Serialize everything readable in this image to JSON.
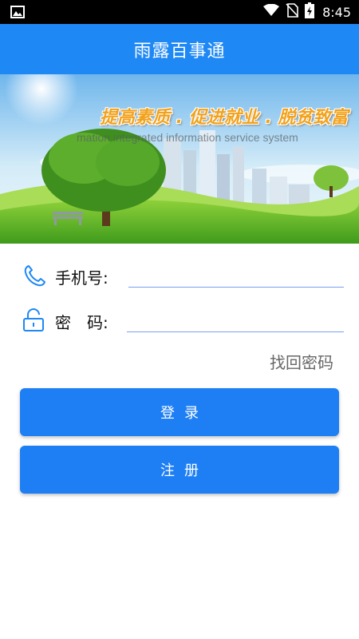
{
  "status_bar": {
    "time": "8:45",
    "icons": [
      "image-icon",
      "wifi-icon",
      "no-sim-icon",
      "battery-charging-icon"
    ]
  },
  "app_bar": {
    "title": "雨露百事通"
  },
  "banner": {
    "slogan": "提高素质 . 促进就业 . 脱贫致富",
    "subtitle": "mation integrated information service system"
  },
  "login_form": {
    "phone_label": "手机号:",
    "phone_value": "",
    "password_label": "密　码:",
    "password_value": "",
    "forgot_password": "找回密码",
    "login_button": "登录",
    "register_button": "注册"
  },
  "colors": {
    "primary": "#1e88f5",
    "button": "#1e7ff5",
    "field_underline": "#7a9ff0",
    "icon": "#1e88f5"
  }
}
